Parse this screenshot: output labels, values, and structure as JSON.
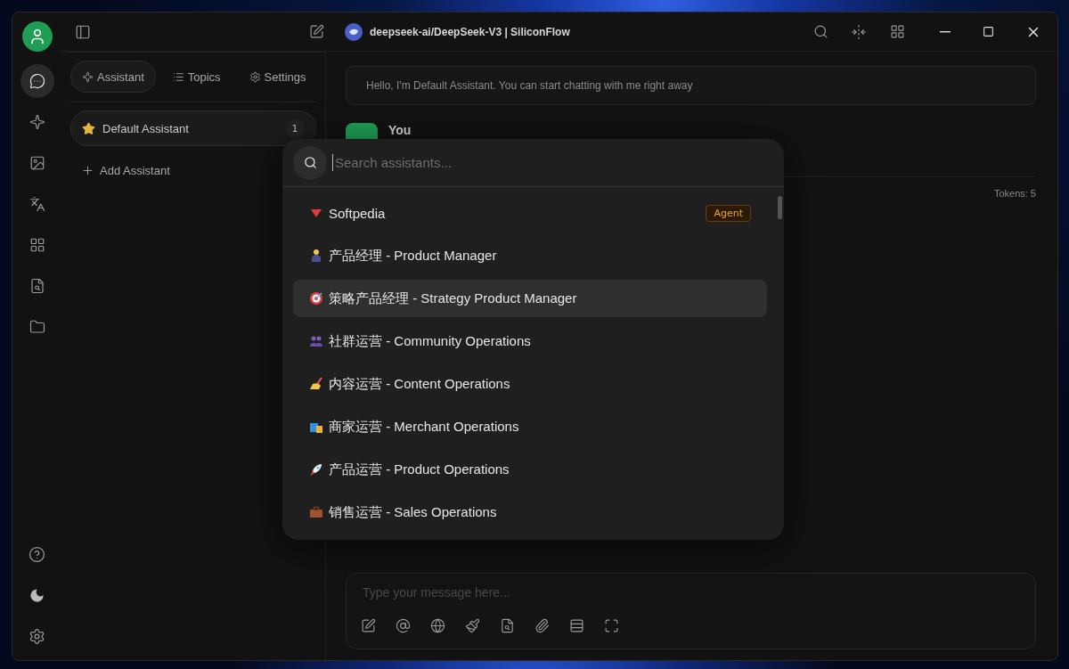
{
  "window": {
    "title": "deepseek-ai/DeepSeek-V3 | SiliconFlow"
  },
  "rail": [
    {
      "selected": true
    },
    {
      "selected": false
    },
    {
      "selected": false
    },
    {
      "selected": false
    },
    {
      "selected": false
    },
    {
      "selected": false
    },
    {
      "selected": false
    }
  ],
  "sidebar": {
    "tabs": [
      {
        "label": "Assistant",
        "selected": true
      },
      {
        "label": "Topics",
        "selected": false
      },
      {
        "label": "Settings",
        "selected": false
      }
    ],
    "assistants": [
      {
        "name": "Default Assistant",
        "count": "1",
        "selected": true
      }
    ],
    "add_label": "Add Assistant"
  },
  "chat": {
    "greeting": "Hello, I'm Default Assistant. You can start chatting with me right away",
    "messages": [
      {
        "author": "You"
      }
    ],
    "tokens": "Tokens: 5",
    "input": {
      "placeholder": "Type your message here..."
    }
  },
  "assistant_picker": {
    "search": {
      "placeholder": "Search assistants..."
    },
    "items": [
      {
        "name": "Softpedia",
        "tag": "Agent",
        "selected": false
      },
      {
        "name": "产品经理 - Product Manager",
        "selected": false
      },
      {
        "name": "策略产品经理 - Strategy Product Manager",
        "selected": true
      },
      {
        "name": "社群运营 - Community Operations",
        "selected": false
      },
      {
        "name": "内容运营 - Content Operations",
        "selected": false
      },
      {
        "name": "商家运营 - Merchant Operations",
        "selected": false
      },
      {
        "name": "产品运营 - Product Operations",
        "selected": false
      },
      {
        "name": "销售运营 - Sales Operations",
        "selected": false
      }
    ]
  }
}
